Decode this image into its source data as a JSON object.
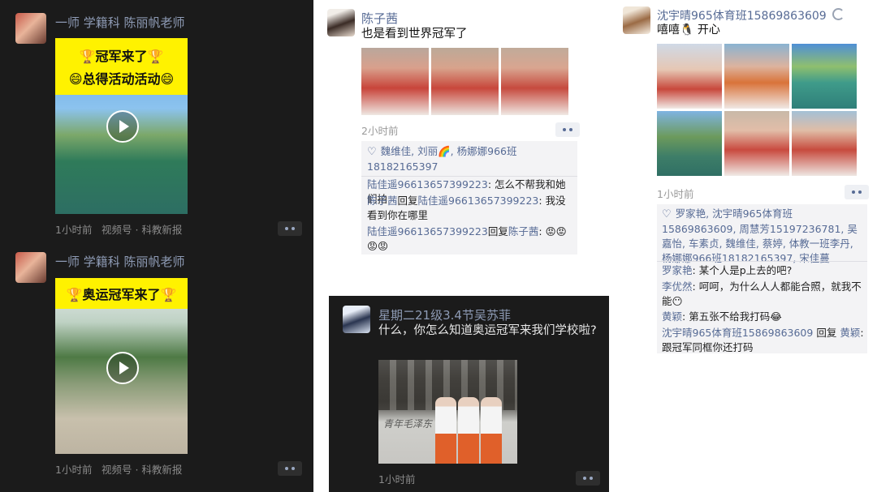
{
  "post1": {
    "author": "一师 学籍科 陈丽帆老师",
    "video_banner_line1": "🏆冠军来了🏆",
    "video_banner_line2": "😄总得活动活动😄",
    "time": "1小时前",
    "source": "视频号 · 科教新报"
  },
  "post2": {
    "author": "一师 学籍科 陈丽帆老师",
    "video_banner": "🏆奥运冠军来了🏆",
    "time": "1小时前",
    "source": "视频号 · 科教新报"
  },
  "post3": {
    "author": "陈子茜",
    "text": "也是看到世界冠军了",
    "time": "2小时前",
    "likes": "魏维佳, 刘丽🌈, 杨娜娜966班18182165397",
    "comments": [
      {
        "name": "陆佳遥96613657399223",
        "reply_to": "",
        "text": "怎么不帮我和她们拍"
      },
      {
        "name": "陈子茜",
        "reply_to": "陆佳遥96613657399223",
        "text": "我没看到你在哪里"
      },
      {
        "name": "陆佳遥96613657399223",
        "reply_to": "陈子茜",
        "text": "😡😡😡😡"
      }
    ],
    "reply_word": "回复"
  },
  "post4": {
    "author": "星期二21级3.4节吴苏菲",
    "text": "什么，你怎么知道奥运冠军来我们学校啦?",
    "time": "1小时前",
    "plaque_text": "青年毛泽东"
  },
  "post5": {
    "author": "沈宇晴965体育班15869863609",
    "text": "嘻嘻🐧 开心",
    "time": "1小时前",
    "likes": "罗家艳, 沈宇晴965体育班15869863609, 周慧芳15197236781, 吴嘉怡, 车素贞, 魏维佳, 蔡婷, 体教一班李丹, 杨娜娜966班18182165397, 宋佳蔓",
    "comments": [
      {
        "name": "罗家艳",
        "reply_to": "",
        "text": "某个人是p上去的吧?"
      },
      {
        "name": "李优然",
        "reply_to": "",
        "text": "呵呵，为什么人人都能合照，就我不能😶"
      },
      {
        "name": "黄颖",
        "reply_to": "",
        "text": "第五张不给我打码😂"
      },
      {
        "name": "沈宇晴965体育班15869863609",
        "reply_to": "黄颖",
        "text": "跟冠军同框你还打码"
      }
    ],
    "reply_word": " 回复"
  },
  "colors": {
    "link_blue": "#576b95",
    "dark_bg": "#1b1b1b",
    "banner_yellow": "#fff200"
  }
}
